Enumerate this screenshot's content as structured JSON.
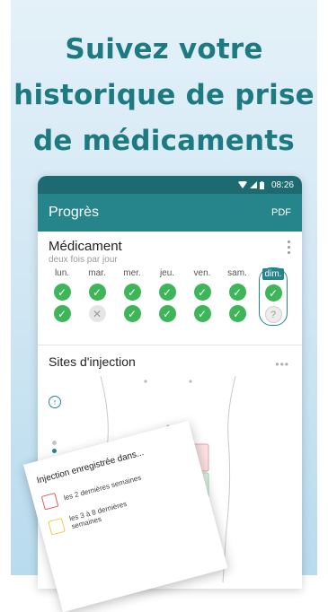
{
  "headline": [
    "Suivez votre",
    "historique de prise",
    "de médicaments"
  ],
  "status": {
    "time": "08:26"
  },
  "appbar": {
    "title": "Progrès",
    "action": "PDF"
  },
  "medication": {
    "name": "Médicament",
    "frequency": "deux fois par jour",
    "days": [
      {
        "label": "lun.",
        "doses": [
          "taken",
          "taken"
        ]
      },
      {
        "label": "mar.",
        "doses": [
          "taken",
          "missed"
        ]
      },
      {
        "label": "mer.",
        "doses": [
          "taken",
          "taken"
        ]
      },
      {
        "label": "jeu.",
        "doses": [
          "taken",
          "taken"
        ]
      },
      {
        "label": "ven.",
        "doses": [
          "taken",
          "taken"
        ]
      },
      {
        "label": "sam.",
        "doses": [
          "taken",
          "taken"
        ]
      },
      {
        "label": "dim.",
        "doses": [
          "taken",
          "pending"
        ],
        "selected": true
      }
    ]
  },
  "sites": {
    "title": "Sites d'injection",
    "menu": "•••"
  },
  "popup": {
    "title": "Injection enregistrée dans...",
    "legend": [
      {
        "label": "les 2 dernières semaines",
        "color": "#e05a5a"
      },
      {
        "label": "les 3 à 8 dernières semaines",
        "color": "#e8d24a"
      }
    ]
  },
  "colors": {
    "accent": "#25858b",
    "headline": "#1e7a81",
    "taken": "#3fb55a"
  },
  "symbols": {
    "check": "✓",
    "missed": "✕",
    "pending": "?",
    "up": "↑"
  }
}
